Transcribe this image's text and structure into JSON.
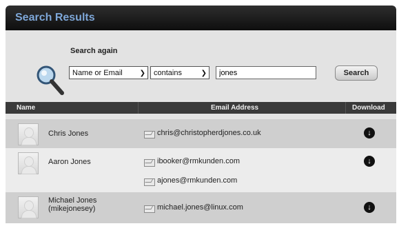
{
  "header": {
    "title": "Search Results"
  },
  "search": {
    "label": "Search again",
    "field_select": "Name or Email",
    "operator_select": "contains",
    "query_value": "jones",
    "button_label": "Search"
  },
  "table": {
    "columns": [
      "Name",
      "Email Address",
      "Download"
    ],
    "rows": [
      {
        "name": "Chris Jones",
        "emails": [
          "chris@christopherdjones.co.uk"
        ]
      },
      {
        "name": "Aaron Jones",
        "emails": [
          "ibooker@rmkunden.com",
          "ajones@rmkunden.com"
        ]
      },
      {
        "name": "Michael Jones\n(mikejonesey)",
        "emails": [
          "michael.jones@linux.com"
        ]
      }
    ]
  },
  "icons": {
    "magnifier": "magnifier-icon",
    "avatar": "avatar-placeholder-icon",
    "email": "envelope-icon",
    "download": "download-arrow-icon"
  },
  "colors": {
    "title_text": "#7ea7d8",
    "title_bar": "#1a1a1a",
    "table_header": "#3a3a3a",
    "row_shaded": "#cfcfcf",
    "row_light": "#ececec"
  }
}
